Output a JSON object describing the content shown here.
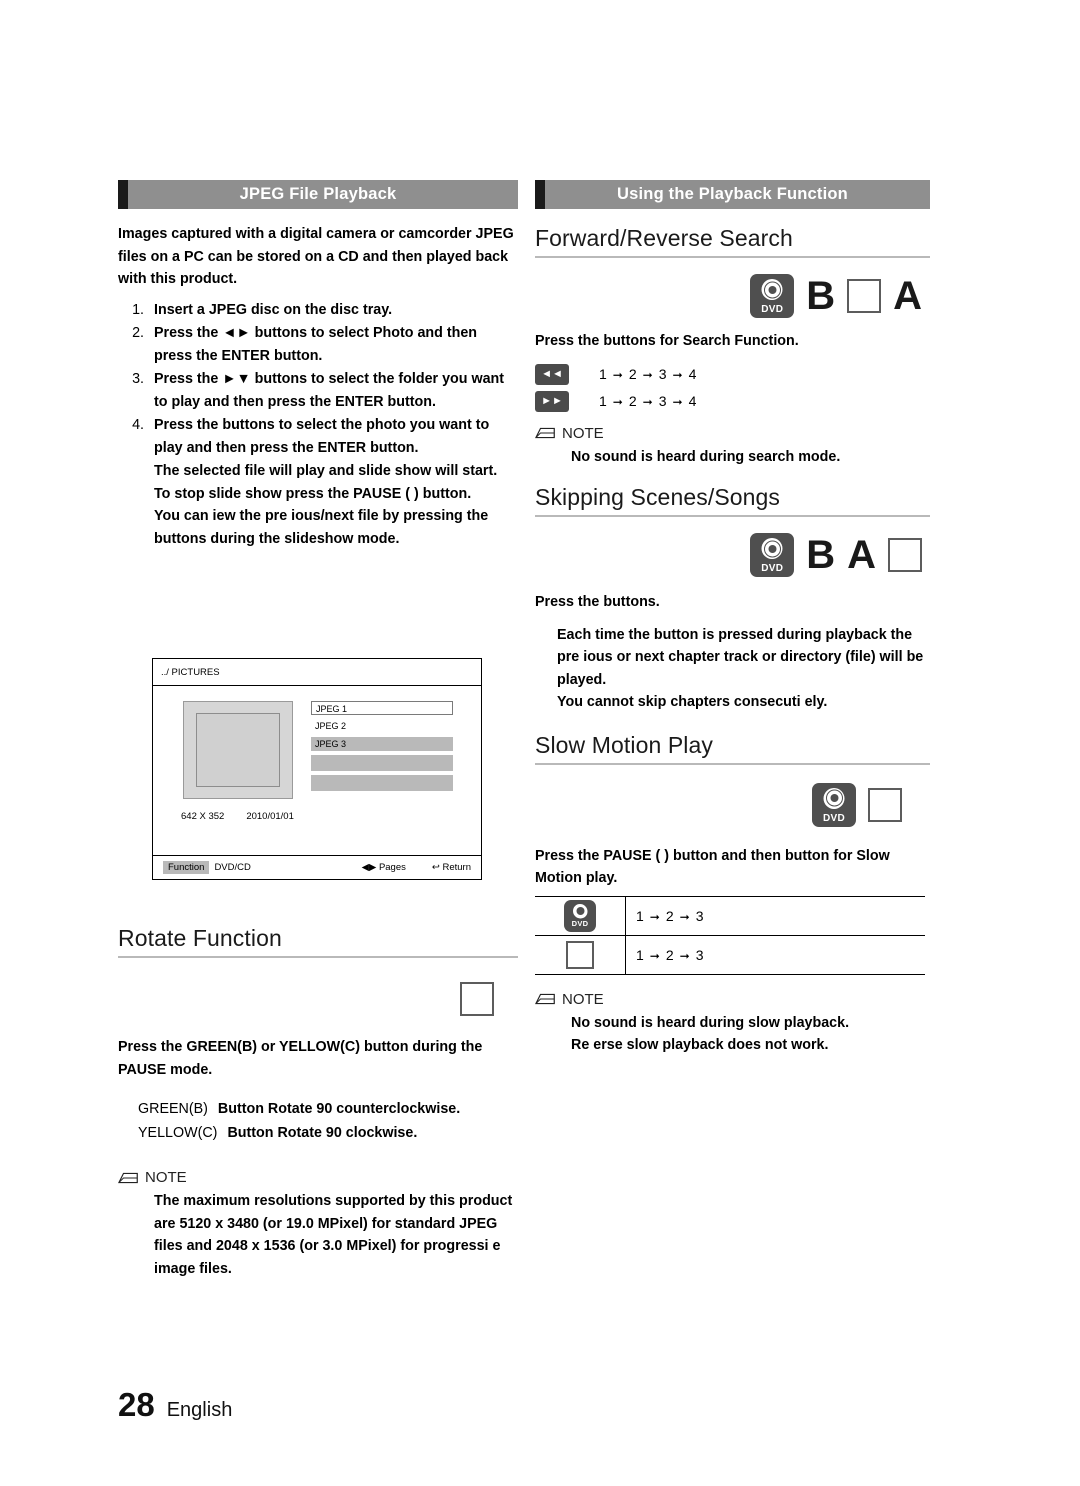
{
  "page": {
    "number": "28",
    "language": "English"
  },
  "left": {
    "section_title": "JPEG File Playback",
    "intro": "Images captured with a digital camera or camcorder JPEG files on a PC can be stored on a CD and then played back with this product.",
    "steps": [
      {
        "num": "1.",
        "text": "Insert a JPEG disc on the disc tray."
      },
      {
        "num": "2.",
        "text": "Press the ◄► buttons to select Photo and then press the ENTER button."
      },
      {
        "num": "3.",
        "text": "Press the ►▼ buttons to select the folder you want to play and then press the ENTER button."
      },
      {
        "num": "4.",
        "text": "Press the buttons to select the photo you want to play and then press the ENTER button."
      }
    ],
    "after_steps": [
      "The selected file will play and slide show will start.",
      "To stop slide show  press the PAUSE ( ) button.",
      "You can  iew the pre  ious/next file by pressing the  buttons during the slideshow mode."
    ],
    "screen": {
      "path": "../ PICTURES",
      "files": [
        "JPEG 1",
        "JPEG 2",
        "JPEG 3"
      ],
      "resolution": "642 X 352",
      "date": "2010/01/01",
      "function_chip": "Function",
      "function_value": "DVD/CD",
      "pages_label": "Pages",
      "return_label": "Return"
    },
    "rotate": {
      "heading": "Rotate Function",
      "instruction": "Press the GREEN(B) or YELLOW(C) button during the PAUSE mode.",
      "rows": [
        {
          "key": "GREEN(B)",
          "text": "Button   Rotate 90   counterclockwise."
        },
        {
          "key": "YELLOW(C)",
          "text": "Button Rotate 90   clockwise."
        }
      ],
      "note_label": "NOTE",
      "note_text": "The maximum resolutions supported by this product are 5120 x 3480 (or 19.0 MPixel) for standard JPEG files and 2048 x 1536 (or 3.0 MPixel) for progressi  e image files."
    }
  },
  "right": {
    "section_title": "Using the Playback  Function",
    "forward_reverse": {
      "heading": "Forward/Reverse Search",
      "badges": [
        "DVD",
        "B",
        "box",
        "A"
      ],
      "instruction": "Press the  buttons for Search Function.",
      "rows": [
        {
          "icon": "◄◄",
          "steps": [
            "1",
            "2",
            "3",
            "4"
          ]
        },
        {
          "icon": "►►",
          "steps": [
            "1",
            "2",
            "3",
            "4"
          ]
        }
      ],
      "note_label": "NOTE",
      "note_text": "No sound is heard during search mode."
    },
    "skipping": {
      "heading": "Skipping Scenes/Songs",
      "badges": [
        "DVD",
        "B",
        "A",
        "box"
      ],
      "instruction": "Press the  buttons.",
      "lines": [
        "Each time the button is pressed during playback the pre  ious or next chapter   track or directory (file) will be played.",
        "You cannot skip chapters consecuti  ely."
      ]
    },
    "slow_motion": {
      "heading": "Slow Motion Play",
      "badges": [
        "DVD",
        "box"
      ],
      "instruction": "Press the PAUSE ( ) button and then   button for Slow Motion play.",
      "rows": [
        {
          "icon": "DVD",
          "steps": [
            "1",
            "2",
            "3"
          ]
        },
        {
          "icon": "box",
          "steps": [
            "1",
            "2",
            "3"
          ]
        }
      ],
      "note_label": "NOTE",
      "note_lines": [
        "No sound is heard during slow playback.",
        "Re  erse slow playback does not work."
      ]
    }
  }
}
